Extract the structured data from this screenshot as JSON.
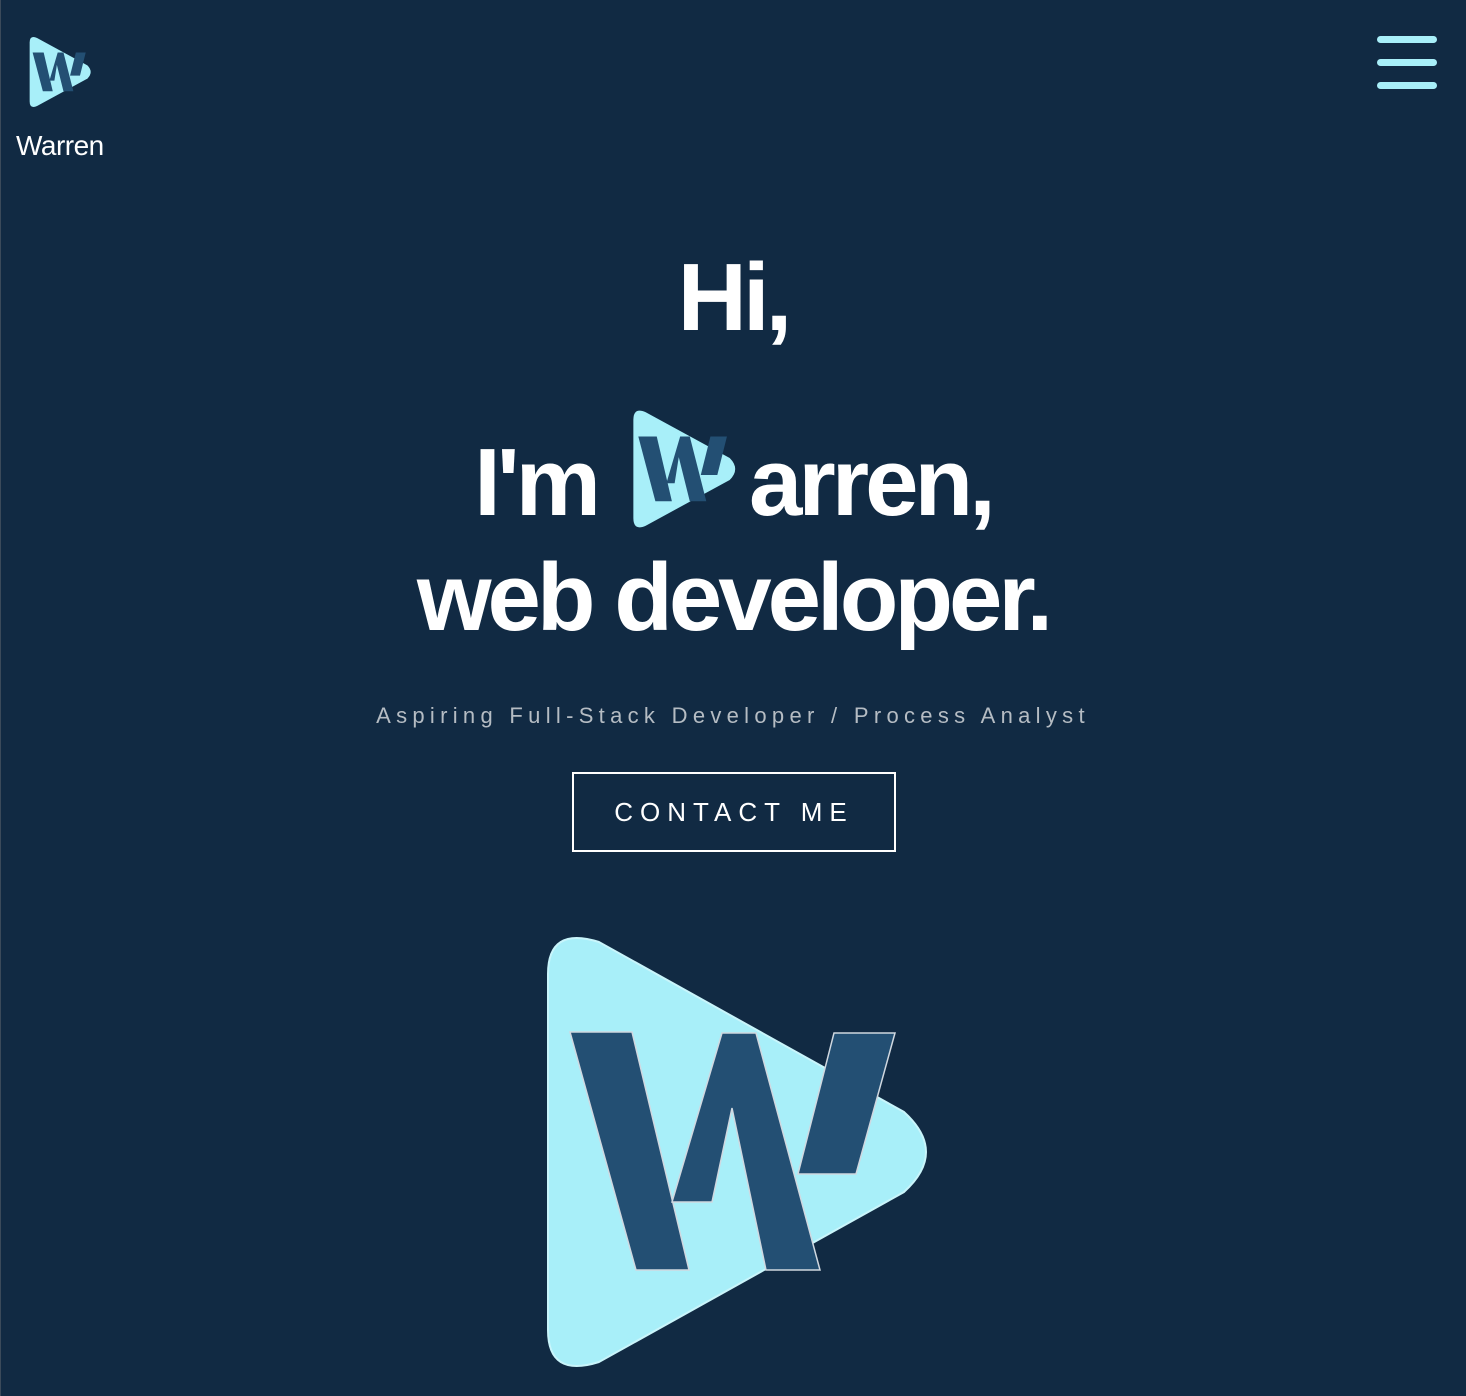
{
  "header": {
    "brand_name": "Warren",
    "menu_icon": "hamburger-menu-icon"
  },
  "hero": {
    "line1": "Hi,",
    "line2_prefix": "I'm",
    "line2_suffix": "arren,",
    "line3": "web developer.",
    "subtitle": "Aspiring Full-Stack Developer / Process Analyst",
    "cta_label": "CONTACT ME"
  },
  "colors": {
    "background": "#112a43",
    "accent": "#a8eff9",
    "logo_letter": "#234f73",
    "text": "#ffffff",
    "muted_text": "#b5bcc3"
  }
}
